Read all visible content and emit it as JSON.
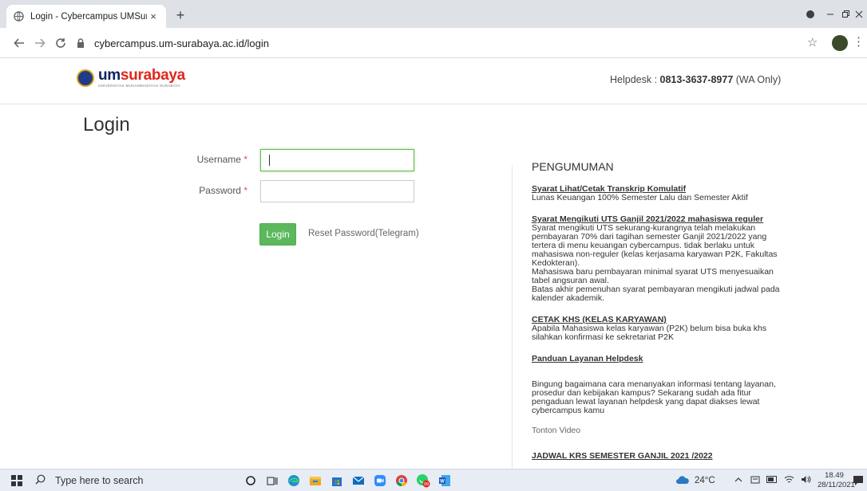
{
  "browser": {
    "tab_title": "Login - Cybercampus UMSuraba",
    "tab_close": "×",
    "new_tab": "+",
    "url": "cybercampus.um-surabaya.ac.id/login"
  },
  "header": {
    "brand_um": "um",
    "brand_surabaya": "surabaya",
    "brand_sub": "UNIVERSITAS MUHAMMADIYAH SURABAYA",
    "helpdesk_prefix": "Helpdesk : ",
    "helpdesk_number": "0813-3637-8977",
    "helpdesk_suffix": " (WA Only)"
  },
  "login": {
    "title": "Login",
    "username_label": "Username",
    "password_label": "Password",
    "required_mark": "*",
    "username_value": "",
    "password_value": "",
    "submit_label": "Login",
    "reset_label": "Reset Password(Telegram)"
  },
  "announcements": {
    "heading": "PENGUMUMAN",
    "items": [
      {
        "title": "Syarat Lihat/Cetak Transkrip Komulatif",
        "lines": [
          "Lunas Keuangan 100% Semester Lalu dan Semester Aktif"
        ]
      },
      {
        "title": "Syarat Mengikuti UTS Ganjil 2021/2022 mahasiswa reguler",
        "lines": [
          "Syarat mengikuti UTS sekurang-kurangnya telah melakukan",
          "pembayaran 70% dari tagihan semester Ganjil 2021/2022 yang",
          "tertera di menu keuangan cybercampus. tidak berlaku untuk",
          "mahasiswa non-reguler (kelas kerjasama karyawan P2K, Fakultas",
          "Kedokteran).",
          "Mahasiswa baru pembayaran minimal syarat UTS menyesuaikan",
          "tabel angsuran awal.",
          "Batas akhir pemenuhan syarat pembayaran mengikuti jadwal pada",
          "kalender akademik."
        ]
      },
      {
        "title": "CETAK KHS (KELAS KARYAWAN)",
        "lines": [
          "Apabila Mahasiswa kelas karyawan (P2K) belum bisa buka khs",
          "silahkan konfirmasi ke sekretariat P2K"
        ]
      },
      {
        "title": "Panduan Layanan Helpdesk",
        "lines": []
      }
    ],
    "helpdesk_text": [
      "Bingung bagaimana cara menanyakan informasi tentang layanan,",
      "prosedur dan kebijakan kampus? Sekarang sudah ada fitur",
      "pengaduan lewat layanan helpdesk yang dapat diakses lewat",
      "cybercampus kamu"
    ],
    "video_label": "Tonton Video",
    "krs_title": "JADWAL KRS SEMESTER GANJIL 2021 /2022"
  },
  "taskbar": {
    "search_placeholder": "Type here to search",
    "temperature": "24°C",
    "time": "18.49",
    "date": "28/11/2021",
    "whatsapp_badge": "99"
  },
  "icons": {
    "back": "back-arrow-icon",
    "forward": "forward-arrow-icon",
    "reload": "reload-icon",
    "lock": "lock-icon",
    "star": "bookmark-star-icon"
  },
  "colors": {
    "login_button": "#5cb85c",
    "focused_border": "#66bb4a",
    "brand_navy": "#0b2462",
    "brand_red": "#e0261b"
  }
}
